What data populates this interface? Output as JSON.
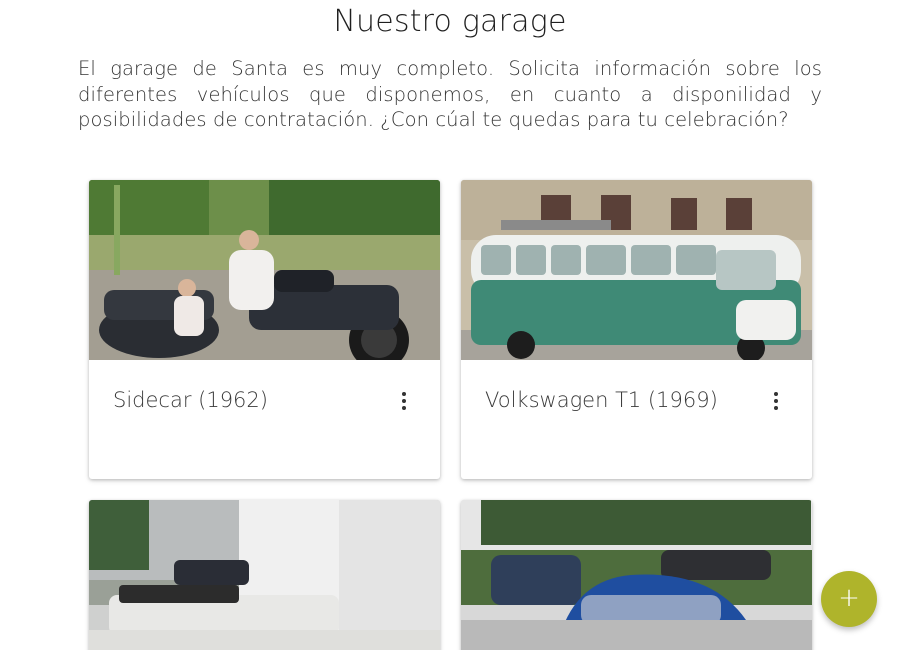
{
  "header": {
    "title": "Nuestro garage",
    "intro": "El garage de Santa es muy completo. Solicita información sobre los diferentes vehículos que disponemos, en cuanto a disponilidad y posibilidades de contratación. ¿Con cúal te quedas para tu celebración?"
  },
  "cards": [
    {
      "name": "Sidecar (1962)",
      "menu_icon": "more-vert-icon"
    },
    {
      "name": "Volkswagen T1 (1969)",
      "menu_icon": "more-vert-icon"
    },
    {
      "name": "",
      "menu_icon": ""
    },
    {
      "name": "",
      "menu_icon": ""
    }
  ],
  "fab": {
    "label": "+",
    "icon": "add-icon",
    "color": "#afb42b"
  }
}
